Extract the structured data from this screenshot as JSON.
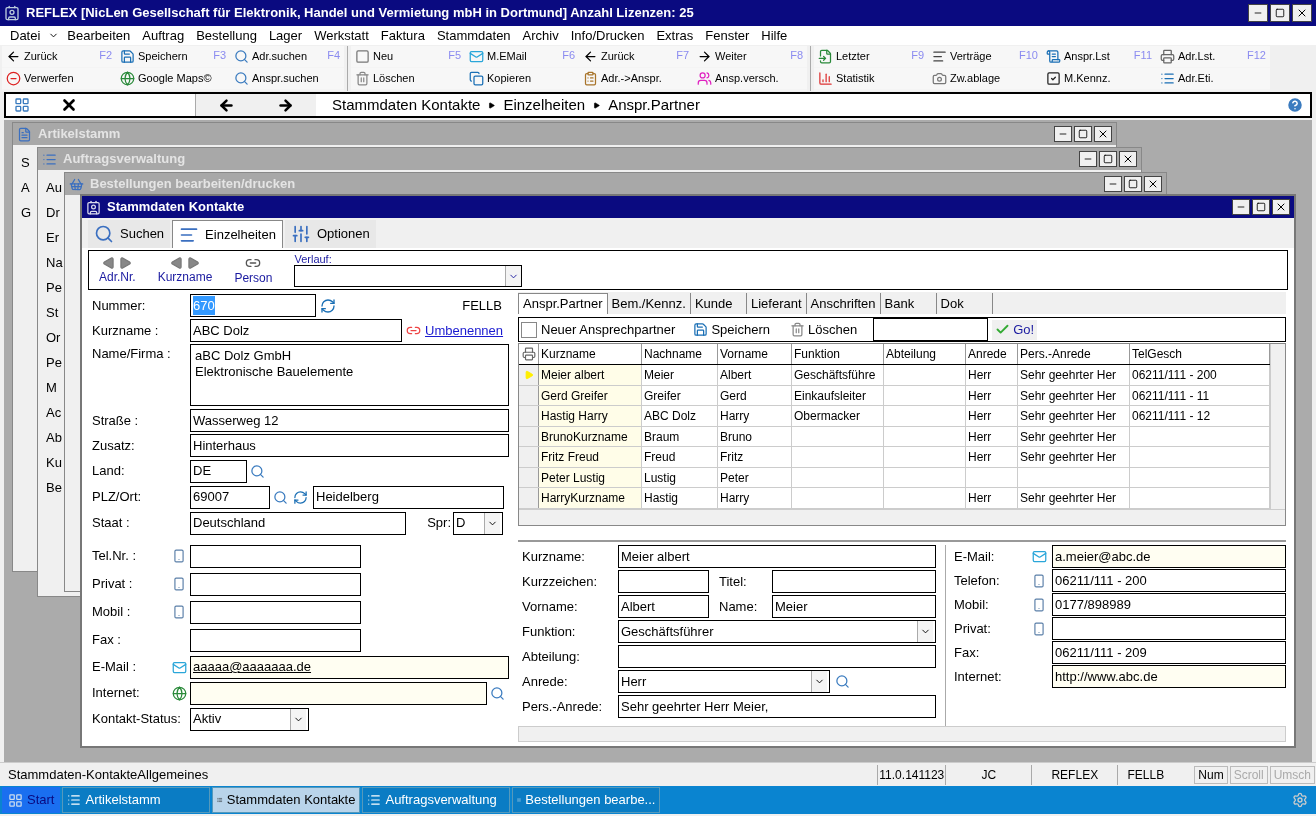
{
  "window": {
    "title": "REFLEX [NicLen Gesellschaft für Elektronik, Handel und Vermietung mbH in Dortmund] Anzahl Lizenzen: 25"
  },
  "menu": [
    "Datei",
    "Bearbeiten",
    "Auftrag",
    "Bestellung",
    "Lager",
    "Werkstatt",
    "Faktura",
    "Stammdaten",
    "Archiv",
    "Info/Drucken",
    "Extras",
    "Fenster",
    "Hilfe"
  ],
  "toolbar": [
    [
      {
        "fkey": "F2",
        "top": "Zurück",
        "bottom": "Verwerfen"
      },
      {
        "fkey": "F3",
        "top": "Speichern",
        "bottom": "Google Maps©"
      },
      {
        "fkey": "F4",
        "top": "Adr.suchen",
        "bottom": "Anspr.suchen"
      }
    ],
    [
      {
        "fkey": "F5",
        "top": "Neu",
        "bottom": "Löschen"
      },
      {
        "fkey": "F6",
        "top": "M.EMail",
        "bottom": "Kopieren"
      },
      {
        "fkey": "F7",
        "top": "Zurück",
        "bottom": "Adr.->Anspr."
      },
      {
        "fkey": "F8",
        "top": "Weiter",
        "bottom": "Ansp.versch."
      }
    ],
    [
      {
        "fkey": "F9",
        "top": "Letzter",
        "bottom": "Statistik"
      },
      {
        "fkey": "F10",
        "top": "Verträge",
        "bottom": "Zw.ablage"
      },
      {
        "fkey": "F11",
        "top": "Anspr.Lst",
        "bottom": "M.Kennz."
      },
      {
        "fkey": "F12",
        "top": "Adr.Lst.",
        "bottom": "Adr.Eti."
      }
    ]
  ],
  "breadcrumb": [
    "Stammdaten Kontakte",
    "Einzelheiten",
    "Anspr.Partner"
  ],
  "background_windows": [
    {
      "title": "Artikelstamm",
      "fragments": [
        "S",
        "A",
        "G"
      ]
    },
    {
      "title": "Auftragsverwaltung",
      "fragments": [
        "Au",
        "Dr",
        "Er",
        "Na",
        "Pe",
        "St",
        "Or",
        "Pe",
        "M",
        "Ac",
        "Ab",
        "Ku",
        "Be"
      ]
    },
    {
      "title": "Bestellungen bearbeiten/drucken"
    }
  ],
  "main": {
    "title": "Stammdaten Kontakte",
    "view_tabs": [
      {
        "label": "Suchen",
        "selected": false
      },
      {
        "label": "Einzelheiten",
        "selected": true
      },
      {
        "label": "Optionen",
        "selected": false
      }
    ],
    "nav": [
      "Adr.Nr.",
      "Kurzname",
      "Person"
    ],
    "history_label": "Verlauf:",
    "form": {
      "nummer": {
        "label": "Nummer:",
        "value": "670",
        "tag": "FELLB"
      },
      "kurzname": {
        "label": "Kurzname :",
        "value": "ABC Dolz",
        "link": "Umbenennen"
      },
      "name": {
        "label": "Name/Firma :",
        "lines": [
          "aBC Dolz GmbH",
          "Elektronische Bauelemente"
        ]
      },
      "strasse": {
        "label": "Straße :",
        "value": "Wasserweg 12"
      },
      "zusatz": {
        "label": "Zusatz:",
        "value": "Hinterhaus"
      },
      "land": {
        "label": "Land:",
        "value": "DE"
      },
      "plz": {
        "label": "PLZ/Ort:",
        "value": "69007",
        "city": "Heidelberg"
      },
      "staat": {
        "label": "Staat :",
        "value": "Deutschland",
        "lang_label": "Spr:",
        "lang": "D"
      },
      "phones": [
        {
          "label": "Tel.Nr. :"
        },
        {
          "label": "Privat :"
        },
        {
          "label": "Mobil :"
        }
      ],
      "fax": {
        "label": "Fax :"
      },
      "email": {
        "label": "E-Mail :",
        "value": "aaaaa@aaaaaaa.de"
      },
      "internet": {
        "label": "Internet:"
      },
      "status": {
        "label": "Kontakt-Status:",
        "value": "Aktiv"
      }
    },
    "right_tabs": [
      {
        "label": "Anspr.Partner",
        "selected": true
      },
      {
        "label": "Bem./Kennz.",
        "selected": false
      },
      {
        "label": "Kunde",
        "selected": false
      },
      {
        "label": "Lieferant",
        "selected": false
      },
      {
        "label": "Anschriften",
        "selected": false
      },
      {
        "label": "Bank",
        "selected": false
      },
      {
        "label": "Dok",
        "selected": false
      }
    ],
    "contact_toolbar": {
      "new_label": "Neuer Ansprechpartner",
      "new_checked": false,
      "save": "Speichern",
      "delete": "Löschen",
      "go": "Go!"
    },
    "table": {
      "columns": [
        "Kurzname",
        "Nachname",
        "Vorname",
        "Funktion",
        "Abteilung",
        "Anrede",
        "Pers.-Anrede",
        "TelGesch"
      ],
      "rows": [
        {
          "selected": true,
          "cells": [
            "Meier albert",
            "Meier",
            "Albert",
            "Geschäftsführe",
            "",
            "Herr",
            "Sehr geehrter Her",
            "06211/111 - 200"
          ]
        },
        {
          "selected": false,
          "cells": [
            "Gerd Greifer",
            "Greifer",
            "Gerd",
            "Einkaufsleiter",
            "",
            "Herr",
            "Sehr geehrter Her",
            "06211/111 - 11"
          ]
        },
        {
          "selected": false,
          "cells": [
            "Hastig Harry",
            "ABC Dolz",
            "Harry",
            "Obermacker",
            "",
            "Herr",
            "Sehr geehrter Her",
            "06211/111 - 12"
          ]
        },
        {
          "selected": false,
          "cells": [
            "BrunoKurzname",
            "Braum",
            "Bruno",
            "",
            "",
            "Herr",
            "Sehr geehrter Her",
            ""
          ]
        },
        {
          "selected": false,
          "cells": [
            "Fritz Freud",
            "Freud",
            "Fritz",
            "",
            "",
            "Herr",
            "Sehr geehrter Her",
            ""
          ]
        },
        {
          "selected": false,
          "cells": [
            "Peter Lustig",
            "Lustig",
            "Peter",
            "",
            "",
            "",
            "",
            ""
          ]
        },
        {
          "selected": false,
          "cells": [
            "HarryKurzname",
            "Hastig",
            "Harry",
            "",
            "",
            "Herr",
            "Sehr geehrter Her",
            ""
          ]
        }
      ]
    },
    "detail": {
      "kurzname": {
        "label": "Kurzname:",
        "value": "Meier albert"
      },
      "kurzzeichen": {
        "label": "Kurzzeichen:"
      },
      "titel": {
        "label": "Titel:"
      },
      "vorname": {
        "label": "Vorname:",
        "value": "Albert"
      },
      "name": {
        "label": "Name:",
        "value": "Meier"
      },
      "funktion": {
        "label": "Funktion:",
        "value": "Geschäftsführer"
      },
      "abteilung": {
        "label": "Abteilung:"
      },
      "anrede": {
        "label": "Anrede:",
        "value": "Herr"
      },
      "pers_anrede": {
        "label": "Pers.-Anrede:",
        "value": "Sehr geehrter Herr Meier,"
      },
      "contacts": [
        {
          "kind": "mail",
          "label": "E-Mail:",
          "value": "a.meier@abc.de"
        },
        {
          "kind": "phone",
          "label": "Telefon:",
          "value": "06211/111 - 200"
        },
        {
          "kind": "phone",
          "label": "Mobil:",
          "value": "0177/898989"
        },
        {
          "kind": "phone",
          "label": "Privat:"
        },
        {
          "kind": "plain",
          "label": "Fax:",
          "value": "06211/111 - 209"
        },
        {
          "kind": "web",
          "label": "Internet:",
          "value": "http://www.abc.de"
        }
      ]
    }
  },
  "status_bar": {
    "message": "Stammdaten-KontakteAllgemeines",
    "cells": [
      "11.0.141123",
      "JC",
      "REFLEX",
      "FELLB"
    ],
    "keys": [
      {
        "label": "Num",
        "on": true
      },
      {
        "label": "Scroll",
        "on": false
      },
      {
        "label": "Umsch",
        "on": false
      }
    ]
  },
  "taskbar": {
    "start": "Start",
    "items": [
      {
        "label": "Artikelstamm",
        "selected": false
      },
      {
        "label": "Stammdaten Kontakte",
        "selected": true
      },
      {
        "label": "Auftragsverwaltung",
        "selected": false
      },
      {
        "label": "Bestellungen bearbe...",
        "selected": false
      }
    ]
  }
}
